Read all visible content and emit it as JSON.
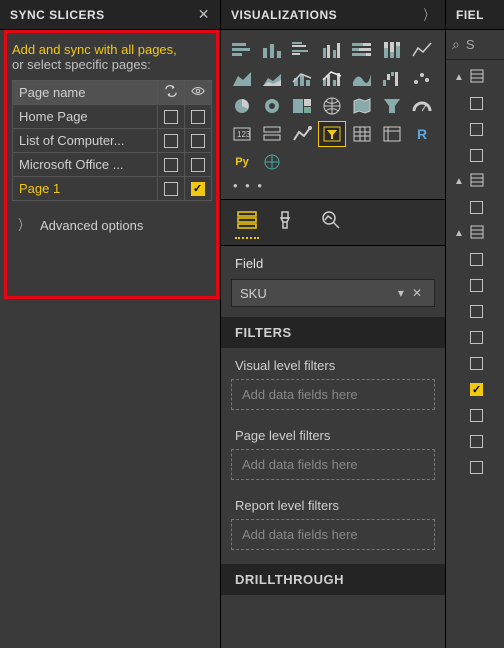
{
  "sync": {
    "title": "SYNC SLICERS",
    "line1": "Add and sync with all pages,",
    "line2": "or select specific pages:",
    "header_col": "Page name",
    "pages": [
      {
        "name": "Home Page",
        "sync": false,
        "vis": false,
        "current": false
      },
      {
        "name": "List of Computer...",
        "sync": false,
        "vis": false,
        "current": false
      },
      {
        "name": "Microsoft Office ...",
        "sync": false,
        "vis": false,
        "current": false
      },
      {
        "name": "Page 1",
        "sync": false,
        "vis": true,
        "current": true
      }
    ],
    "advanced": "Advanced options"
  },
  "viz": {
    "title": "VISUALIZATIONS",
    "field_label": "Field",
    "field_value": "SKU",
    "filters_title": "FILTERS",
    "f_visual": "Visual level filters",
    "f_page": "Page level filters",
    "f_report": "Report level filters",
    "add_placeholder": "Add data fields here",
    "drill_title": "DRILLTHROUGH"
  },
  "fields": {
    "title": "FIEL",
    "search": "S",
    "checks": [
      false,
      false,
      false,
      false,
      false,
      false,
      false,
      false,
      false,
      true,
      false,
      false,
      false
    ]
  },
  "colors": {
    "accent": "#f2c811"
  }
}
